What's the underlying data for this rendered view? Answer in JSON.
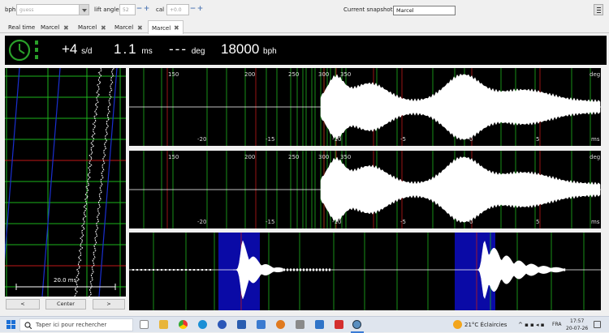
{
  "toolbar": {
    "bph_label": "bph",
    "bph_value": "guess",
    "lift_label": "lift angle",
    "lift_value": "52",
    "cal_label": "cal",
    "cal_value": "+0.0",
    "snapshot_label": "Current snapshot:",
    "snapshot_value": "Marcel"
  },
  "tabs": [
    {
      "label": "Real time"
    },
    {
      "label": "Marcel"
    },
    {
      "label": "Marcel"
    },
    {
      "label": "Marcel"
    },
    {
      "label": "Marcel"
    }
  ],
  "status": {
    "rate": "+4",
    "rate_unit": "s/d",
    "beat_error": "1.1",
    "beat_error_unit": "ms",
    "amplitude": "---",
    "amplitude_unit": "deg",
    "bph": "18000",
    "bph_unit": "bph"
  },
  "paperstrip": {
    "scale_label": "20.0 ms",
    "left_label": "<",
    "center_label": "Center",
    "right_label": ">"
  },
  "scope1": {
    "deg_ticks": [
      "150",
      "200",
      "250",
      "300",
      "350"
    ],
    "deg_unit": "deg",
    "ms_ticks": [
      "-20",
      "-15",
      "-10",
      "-5",
      "0",
      "5"
    ],
    "ms_unit": "ms"
  },
  "scope2": {
    "deg_ticks": [
      "150",
      "200",
      "250",
      "300",
      "350"
    ],
    "deg_unit": "deg",
    "ms_ticks": [
      "-20",
      "-15",
      "-10",
      "-5",
      "0",
      "5"
    ],
    "ms_unit": "ms"
  },
  "taskbar": {
    "search_placeholder": "Taper ici pour rechercher",
    "weather": "21°C Éclaircies",
    "lang": "FRA",
    "time": "17:57",
    "date": "20-07-26"
  },
  "colors": {
    "accent_green": "#2aa02a",
    "grid_green": "#1db31d",
    "grid_red": "#c01818",
    "trace_blue": "#1a2fd0",
    "highlight_blue": "#0a0aa6"
  }
}
